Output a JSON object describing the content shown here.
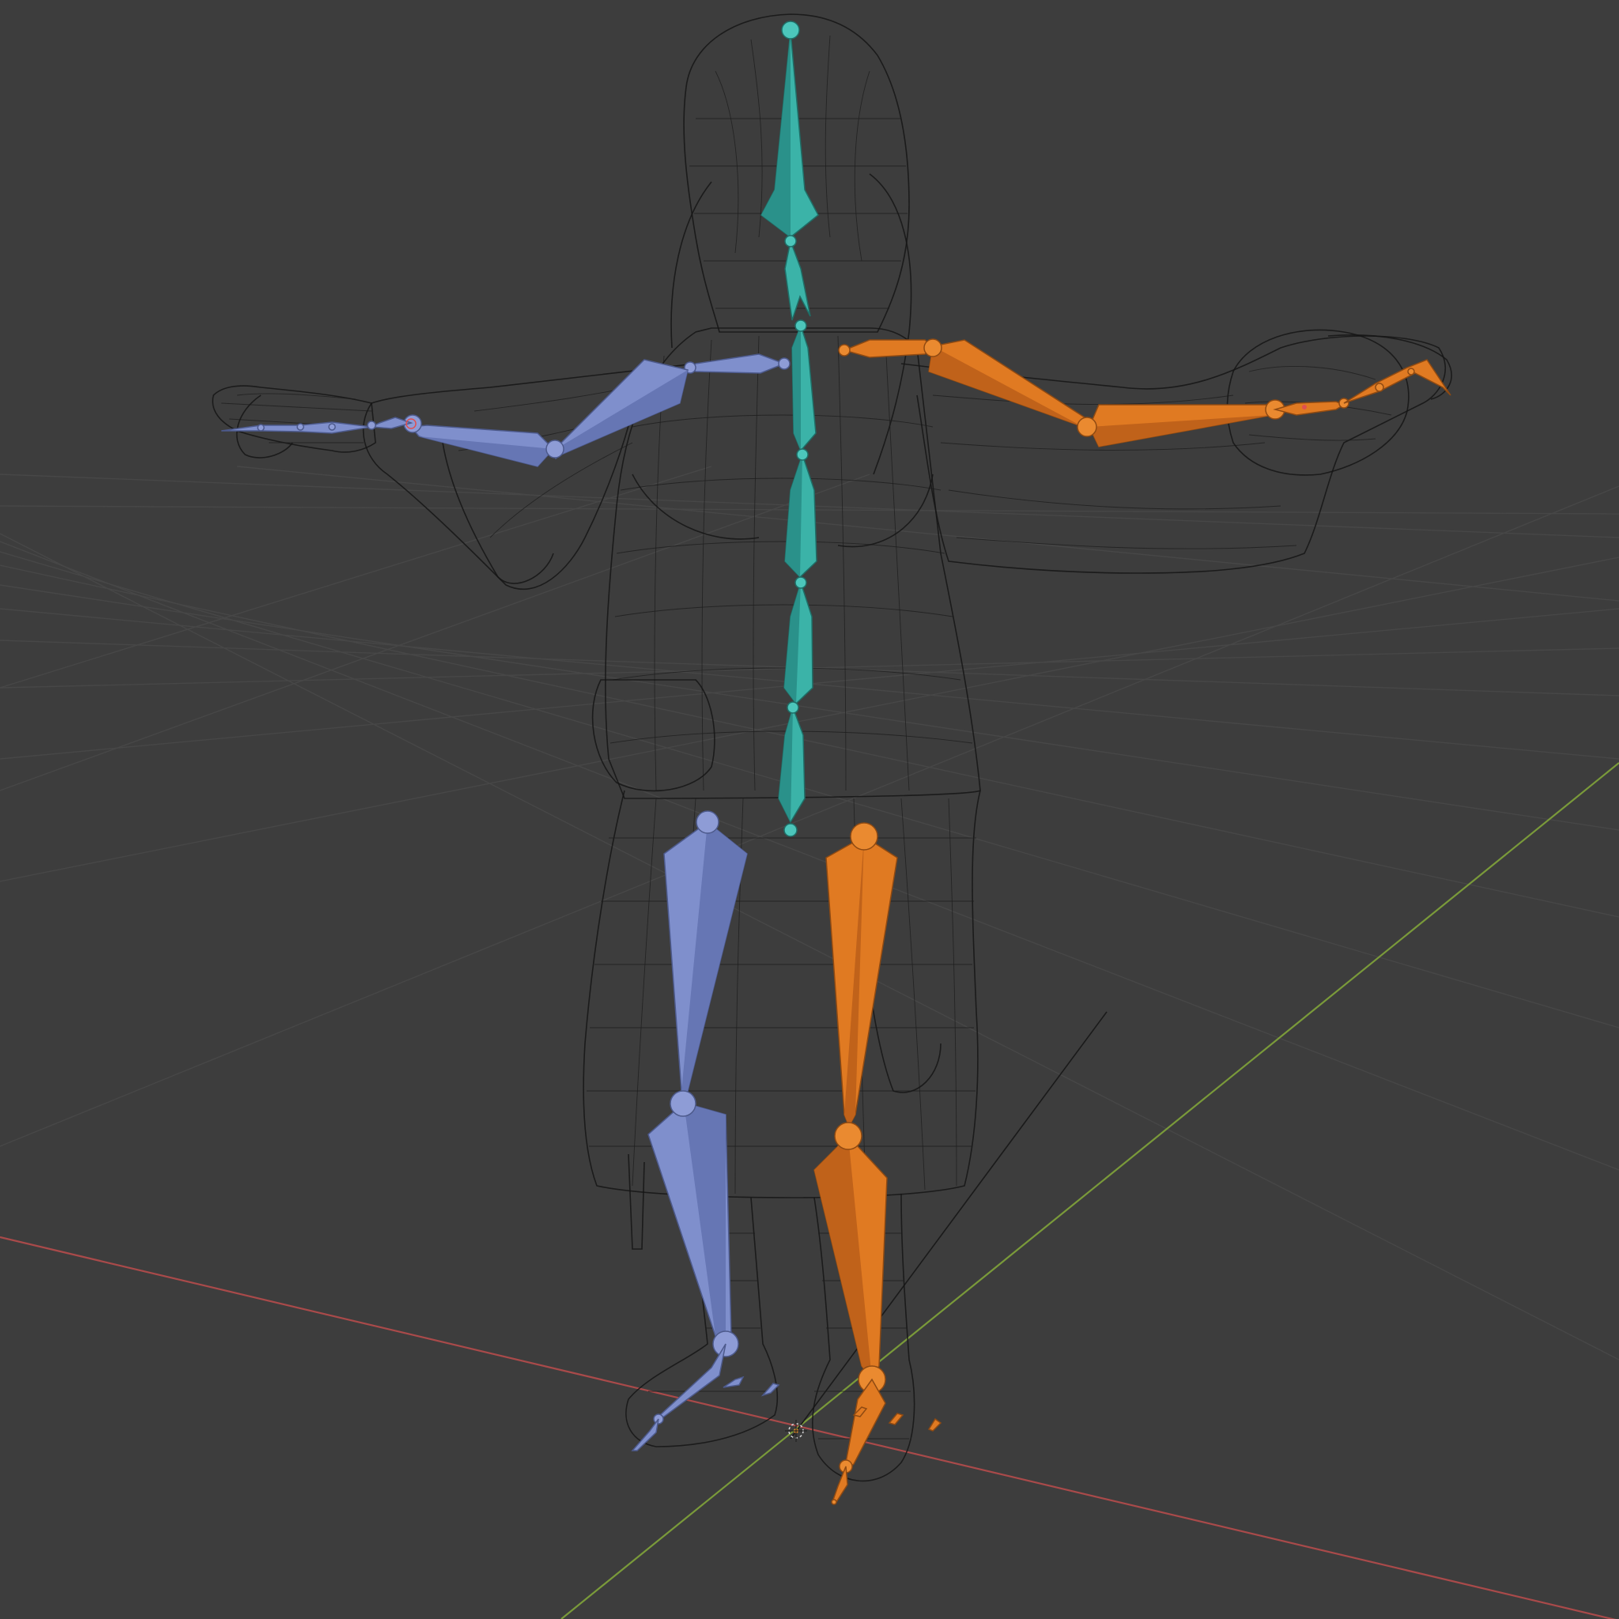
{
  "viewport": {
    "editor": "3d-viewport",
    "shading": "wireframe",
    "background_color": "#3d3d3d",
    "grid_color": "#474747",
    "axis_x_color": "#a94a4a",
    "axis_y_color": "#7a9a3a"
  },
  "armature": {
    "center_bone_color": "#3bb3a8",
    "left_bone_color": "#7f8fcc",
    "right_bone_color": "#e07a22",
    "center_bones": [
      "head",
      "neck",
      "chest",
      "spine-upper",
      "spine-mid",
      "spine-lower",
      "hips"
    ],
    "left_bones": [
      "upper-arm-l",
      "forearm-l",
      "hand-l",
      "fingers-l",
      "thigh-l",
      "shin-l",
      "foot-l",
      "toe-l"
    ],
    "right_bones": [
      "upper-arm-r",
      "forearm-r",
      "hand-r",
      "fingers-r",
      "thigh-r",
      "shin-r",
      "foot-r",
      "toe-r"
    ]
  },
  "mesh": {
    "display": "wireframe",
    "wire_color": "#151515"
  }
}
